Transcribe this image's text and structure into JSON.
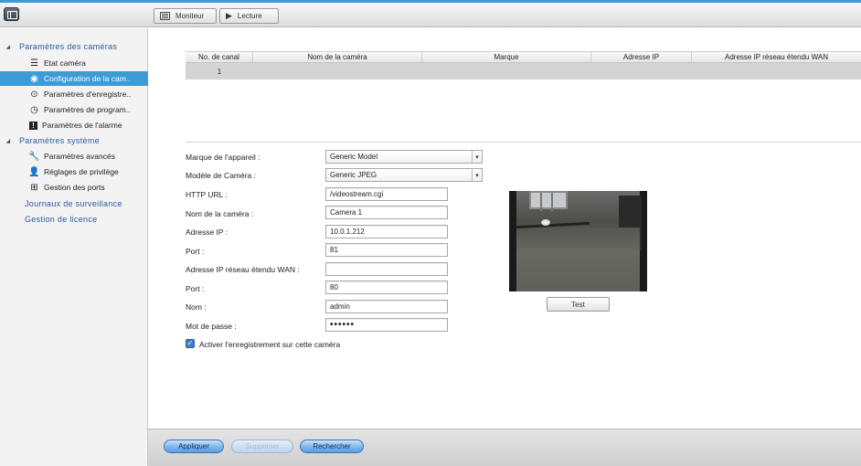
{
  "toolbar": {
    "monitor_label": "Moniteur",
    "playback_label": "Lecture"
  },
  "sidebar": {
    "camera_settings_header": "Paramètres des caméras",
    "camera_items": [
      {
        "label": "Etat caméra",
        "icon": "list-icon"
      },
      {
        "label": "Configuration de la cam..",
        "icon": "camera-icon"
      },
      {
        "label": "Paramètres d'enregistre..",
        "icon": "record-icon"
      },
      {
        "label": "Paramètres de program..",
        "icon": "clock-icon"
      },
      {
        "label": "Paramètres de l'alarme",
        "icon": "alarm-icon"
      }
    ],
    "system_settings_header": "Paramètres système",
    "system_items": [
      {
        "label": "Paramètres avancés",
        "icon": "wrench-icon"
      },
      {
        "label": "Réglages de privilège",
        "icon": "user-icon"
      },
      {
        "label": "Gestion des ports",
        "icon": "network-icon"
      }
    ],
    "surveillance_logs": "Journaux de surveillance",
    "license_management": "Gestion de licence"
  },
  "table": {
    "headers": [
      "No. de canal",
      "Nom de la caméra",
      "Marque",
      "Adresse IP",
      "Adresse IP réseau étendu WAN"
    ],
    "rows": [
      [
        "1",
        "",
        "",
        "",
        ""
      ]
    ]
  },
  "form": {
    "brand_label": "Marque de l'appareil :",
    "brand_value": "Generic Model",
    "model_label": "Modèle de Caméra :",
    "model_value": "Generic JPEG",
    "http_url_label": "HTTP URL :",
    "http_url_value": "/videostream.cgi",
    "camera_name_label": "Nom de la caméra :",
    "camera_name_value": "Camera 1",
    "ip_label": "Adresse IP :",
    "ip_value": "10.0.1.212",
    "port_label": "Port :",
    "port_value": "81",
    "wan_label": "Adresse IP réseau étendu WAN :",
    "wan_value": "",
    "wan_port_label": "Port :",
    "wan_port_value": "80",
    "user_label": "Nom :",
    "user_value": "admin",
    "password_label": "Mot de passe :",
    "password_value": "••••••",
    "record_checkbox_label": "Activer l'enregistrement sur cette caméra",
    "record_checked": true
  },
  "preview": {
    "test_label": "Test"
  },
  "actions": {
    "apply_label": "Appliquer",
    "delete_label": "Supprimer",
    "search_label": "Rechercher"
  },
  "colors": {
    "accent": "#3d9bd6",
    "sidebar_link": "#2a5d9a"
  }
}
